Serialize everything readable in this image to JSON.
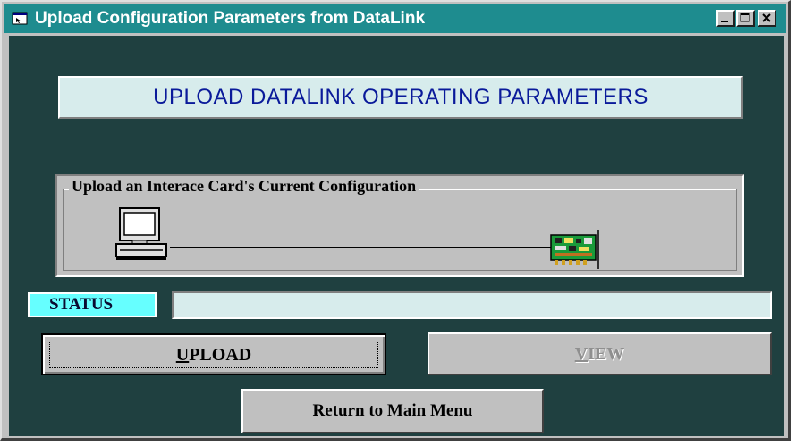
{
  "window": {
    "title": "Upload Configuration Parameters from DataLink",
    "title_icon": "app-window-icon",
    "controls": [
      "minimize-icon",
      "maximize-icon",
      "close-icon"
    ]
  },
  "banner": {
    "text": "UPLOAD DATALINK OPERATING PARAMETERS"
  },
  "group": {
    "label": "Upload an Interace Card's Current Configuration",
    "left_icon": "computer-icon",
    "right_icon": "interface-card-icon"
  },
  "status": {
    "label": "STATUS",
    "value": ""
  },
  "buttons": {
    "upload": {
      "accel": "U",
      "rest": "PLOAD"
    },
    "view": {
      "accel": "V",
      "rest": "IEW",
      "enabled": false
    },
    "return": {
      "accel": "R",
      "rest": "eturn to Main Menu"
    }
  },
  "colors": {
    "titlebar": "#1e8c8f",
    "client_bg": "#1f4040",
    "banner_bg": "#d7ecec",
    "banner_text": "#0a1a9a",
    "status_label_bg": "#66ffff"
  }
}
